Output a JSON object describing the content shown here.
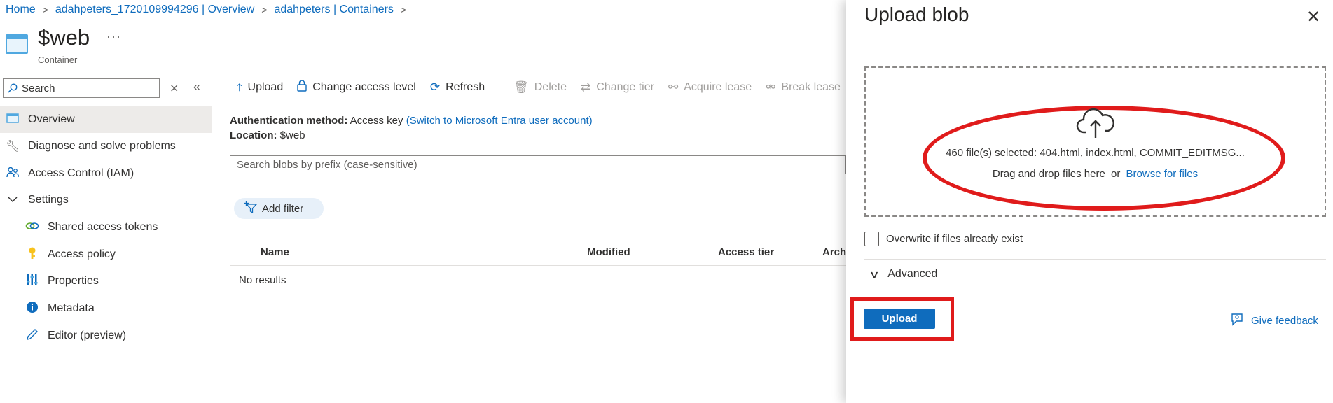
{
  "breadcrumb": {
    "items": [
      "Home",
      "adahpeters_1720109994296 | Overview",
      "adahpeters | Containers"
    ],
    "separator": ">"
  },
  "header": {
    "title": "$web",
    "subtitle": "Container",
    "more_label": "···"
  },
  "sidebar": {
    "search_placeholder": "Search",
    "items": [
      {
        "label": "Overview",
        "icon": "overview-icon",
        "active": true
      },
      {
        "label": "Diagnose and solve problems",
        "icon": "wrench-icon"
      },
      {
        "label": "Access Control (IAM)",
        "icon": "people-icon"
      },
      {
        "label": "Settings",
        "icon": "chevron-down-icon"
      },
      {
        "label": "Shared access tokens",
        "icon": "link-icon"
      },
      {
        "label": "Access policy",
        "icon": "key-icon"
      },
      {
        "label": "Properties",
        "icon": "properties-icon"
      },
      {
        "label": "Metadata",
        "icon": "info-icon"
      },
      {
        "label": "Editor (preview)",
        "icon": "pencil-icon"
      }
    ]
  },
  "toolbar": {
    "upload": "Upload",
    "change_access_level": "Change access level",
    "refresh": "Refresh",
    "delete": "Delete",
    "change_tier": "Change tier",
    "acquire_lease": "Acquire lease",
    "break_lease": "Break lease"
  },
  "details": {
    "auth_label": "Authentication method:",
    "auth_value": "Access key",
    "auth_link": "(Switch to Microsoft Entra user account)",
    "location_label": "Location:",
    "location_value": "$web"
  },
  "blob_search": {
    "placeholder": "Search blobs by prefix (case-sensitive)"
  },
  "filter": {
    "add_filter": "Add filter"
  },
  "table": {
    "columns": [
      "Name",
      "Modified",
      "Access tier",
      "Arch"
    ],
    "empty_text": "No results"
  },
  "panel": {
    "title": "Upload blob",
    "files_selected": "460 file(s) selected: 404.html, index.html, COMMIT_EDITMSG...",
    "drag_text": "Drag and drop files here",
    "or_text": "or",
    "browse_link": "Browse for files",
    "overwrite_label": "Overwrite if files already exist",
    "overwrite_checked": false,
    "advanced_label": "Advanced",
    "upload_button": "Upload",
    "feedback_link": "Give feedback"
  },
  "colors": {
    "accent": "#0f6cbd",
    "annotation": "#e01b1b"
  }
}
